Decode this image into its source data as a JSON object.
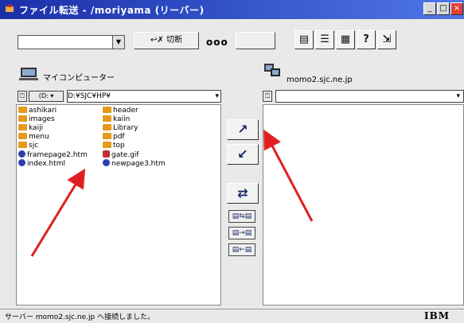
{
  "window": {
    "title": "ファイル転送 - /moriyama (リーバー)"
  },
  "toolbar": {
    "disconnect_label": "↩✗ 切断",
    "dots": "ooo"
  },
  "left": {
    "header": "マイコンピューター",
    "drive": "(D:",
    "path": "D:¥SJC¥HP¥",
    "items_col1": [
      {
        "name": "ashikari",
        "kind": "folder"
      },
      {
        "name": "images",
        "kind": "folder"
      },
      {
        "name": "kaiji",
        "kind": "folder"
      },
      {
        "name": "menu",
        "kind": "folder"
      },
      {
        "name": "sjc",
        "kind": "folder"
      },
      {
        "name": "framepage2.htm",
        "kind": "web"
      },
      {
        "name": "index.html",
        "kind": "web"
      }
    ],
    "items_col2": [
      {
        "name": "header",
        "kind": "folder"
      },
      {
        "name": "kaiin",
        "kind": "folder"
      },
      {
        "name": "Library",
        "kind": "folder"
      },
      {
        "name": "pdf",
        "kind": "folder"
      },
      {
        "name": "top",
        "kind": "folder"
      },
      {
        "name": "gate.gif",
        "kind": "file"
      },
      {
        "name": "newpage3.htm",
        "kind": "web"
      }
    ]
  },
  "right": {
    "header": "momo2.sjc.ne.jp"
  },
  "status": {
    "text": "サーバー momo2.sjc.ne.jp へ接続しました。",
    "brand": "IBM"
  },
  "colors": {
    "titlebar": "#1a2fa8",
    "annotation": "#e02020"
  }
}
